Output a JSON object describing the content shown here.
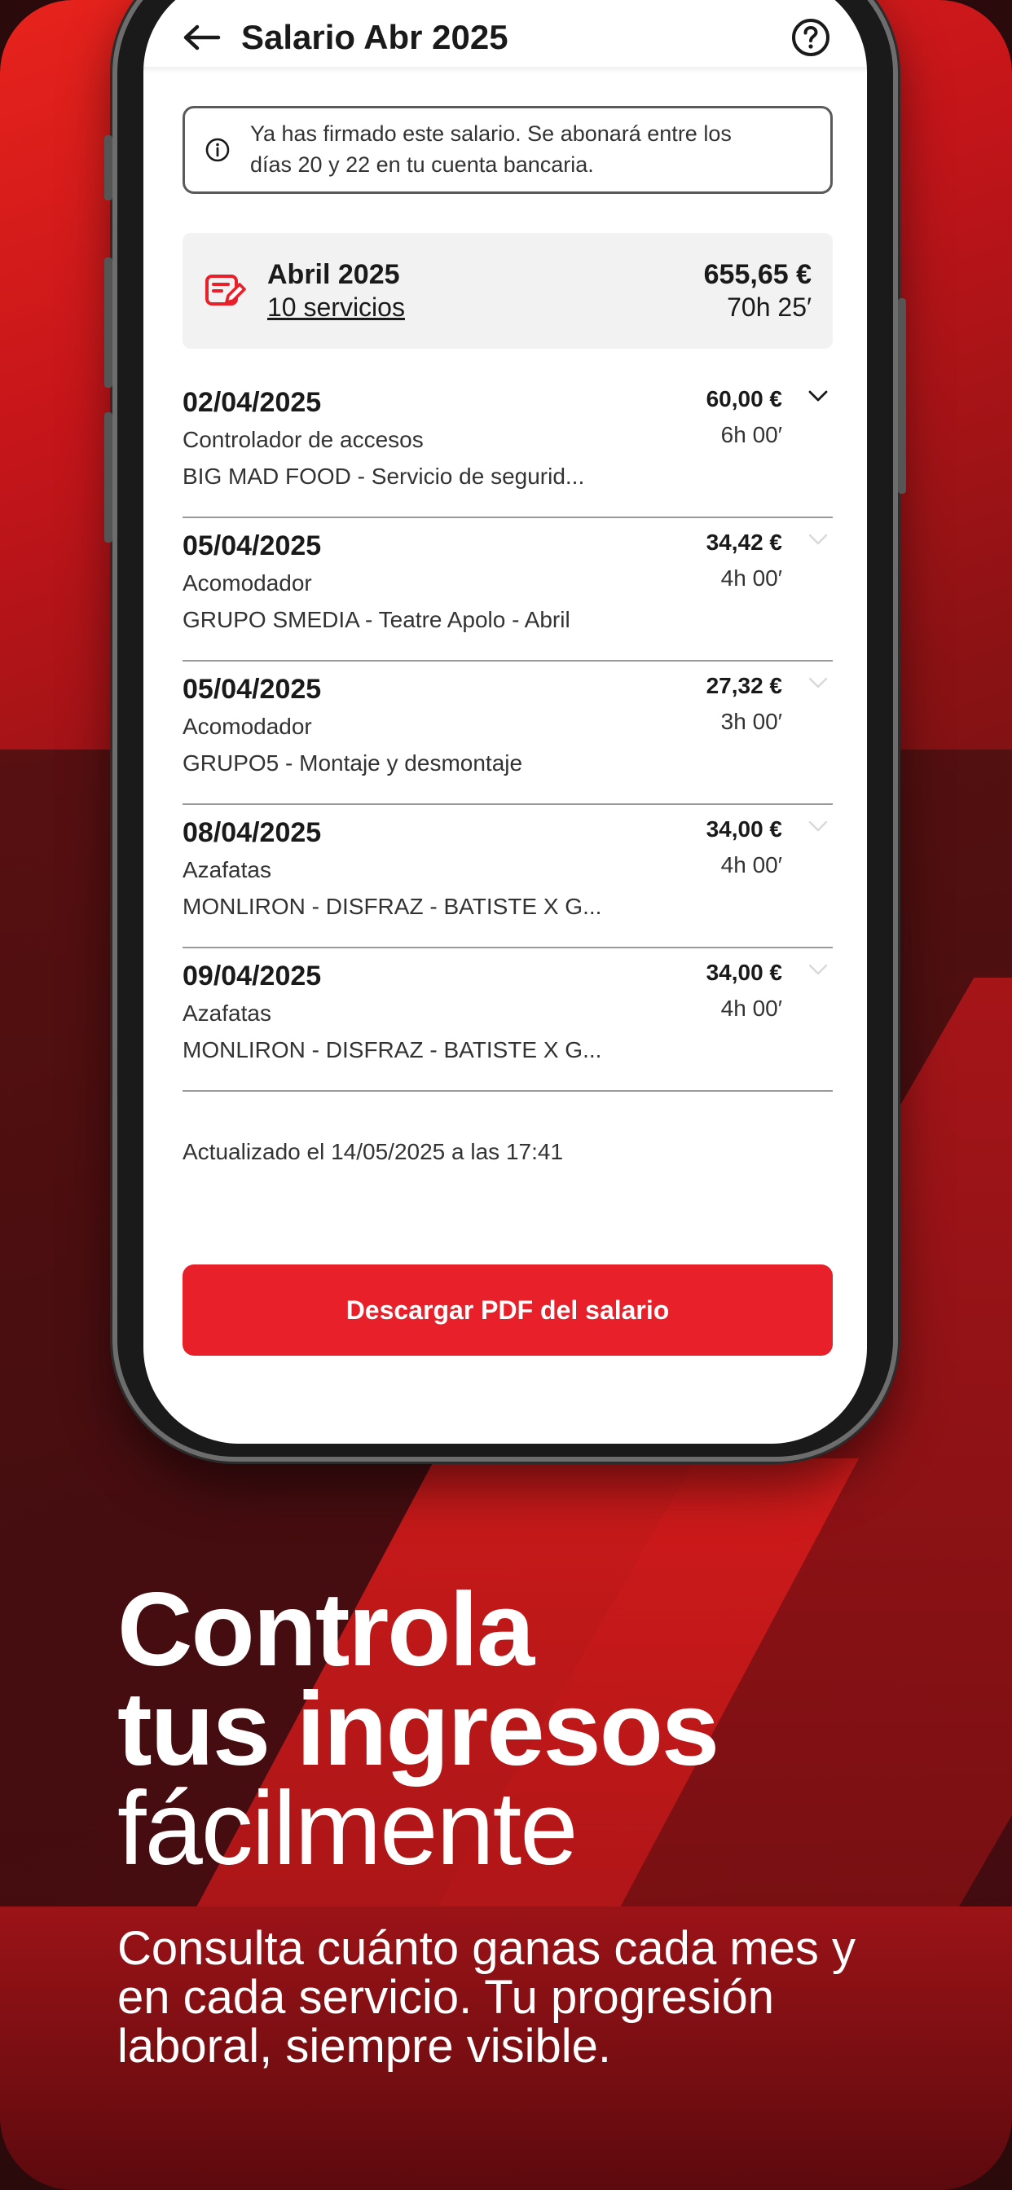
{
  "header": {
    "title": "Salario Abr 2025",
    "back_icon": "arrow-left-icon",
    "help_icon": "question-circle-icon"
  },
  "notice": {
    "icon": "info-icon",
    "line1": "Ya has firmado este salario. Se abonará entre los",
    "line2": "días 20 y 22 en tu cuenta bancaria."
  },
  "summary": {
    "icon": "document-edit-icon",
    "month": "Abril 2025",
    "services": "10 servicios",
    "amount": "655,65 €",
    "hours": "70h 25′"
  },
  "services": [
    {
      "date": "02/04/2025",
      "role": "Controlador de accesos",
      "client": "BIG MAD FOOD - Servicio de segurid...",
      "amount": "60,00 €",
      "hours": "6h 00′",
      "expanded": true
    },
    {
      "date": "05/04/2025",
      "role": "Acomodador",
      "client": "GRUPO SMEDIA - Teatre Apolo - Abril",
      "amount": "34,42 €",
      "hours": "4h 00′",
      "expanded": false
    },
    {
      "date": "05/04/2025",
      "role": "Acomodador",
      "client": "GRUPO5 - Montaje y desmontaje",
      "amount": "27,32 €",
      "hours": "3h 00′",
      "expanded": false
    },
    {
      "date": "08/04/2025",
      "role": "Azafatas",
      "client": "MONLIRON - DISFRAZ - BATISTE X G...",
      "amount": "34,00 €",
      "hours": "4h 00′",
      "expanded": false
    },
    {
      "date": "09/04/2025",
      "role": "Azafatas",
      "client": "MONLIRON - DISFRAZ - BATISTE X G...",
      "amount": "34,00 €",
      "hours": "4h 00′",
      "expanded": false
    }
  ],
  "updated": "Actualizado el 14/05/2025 a las 17:41",
  "download_button": "Descargar PDF del salario",
  "headline": {
    "line1": "Controla",
    "line2": "tus ingresos",
    "line3": "fácilmente"
  },
  "subtitle": "Consulta cuánto ganas cada mes y en cada servicio. Tu progresión laboral, siempre visible.",
  "colors": {
    "brand_red": "#e8202a",
    "background_dark": "#5c0f12"
  }
}
